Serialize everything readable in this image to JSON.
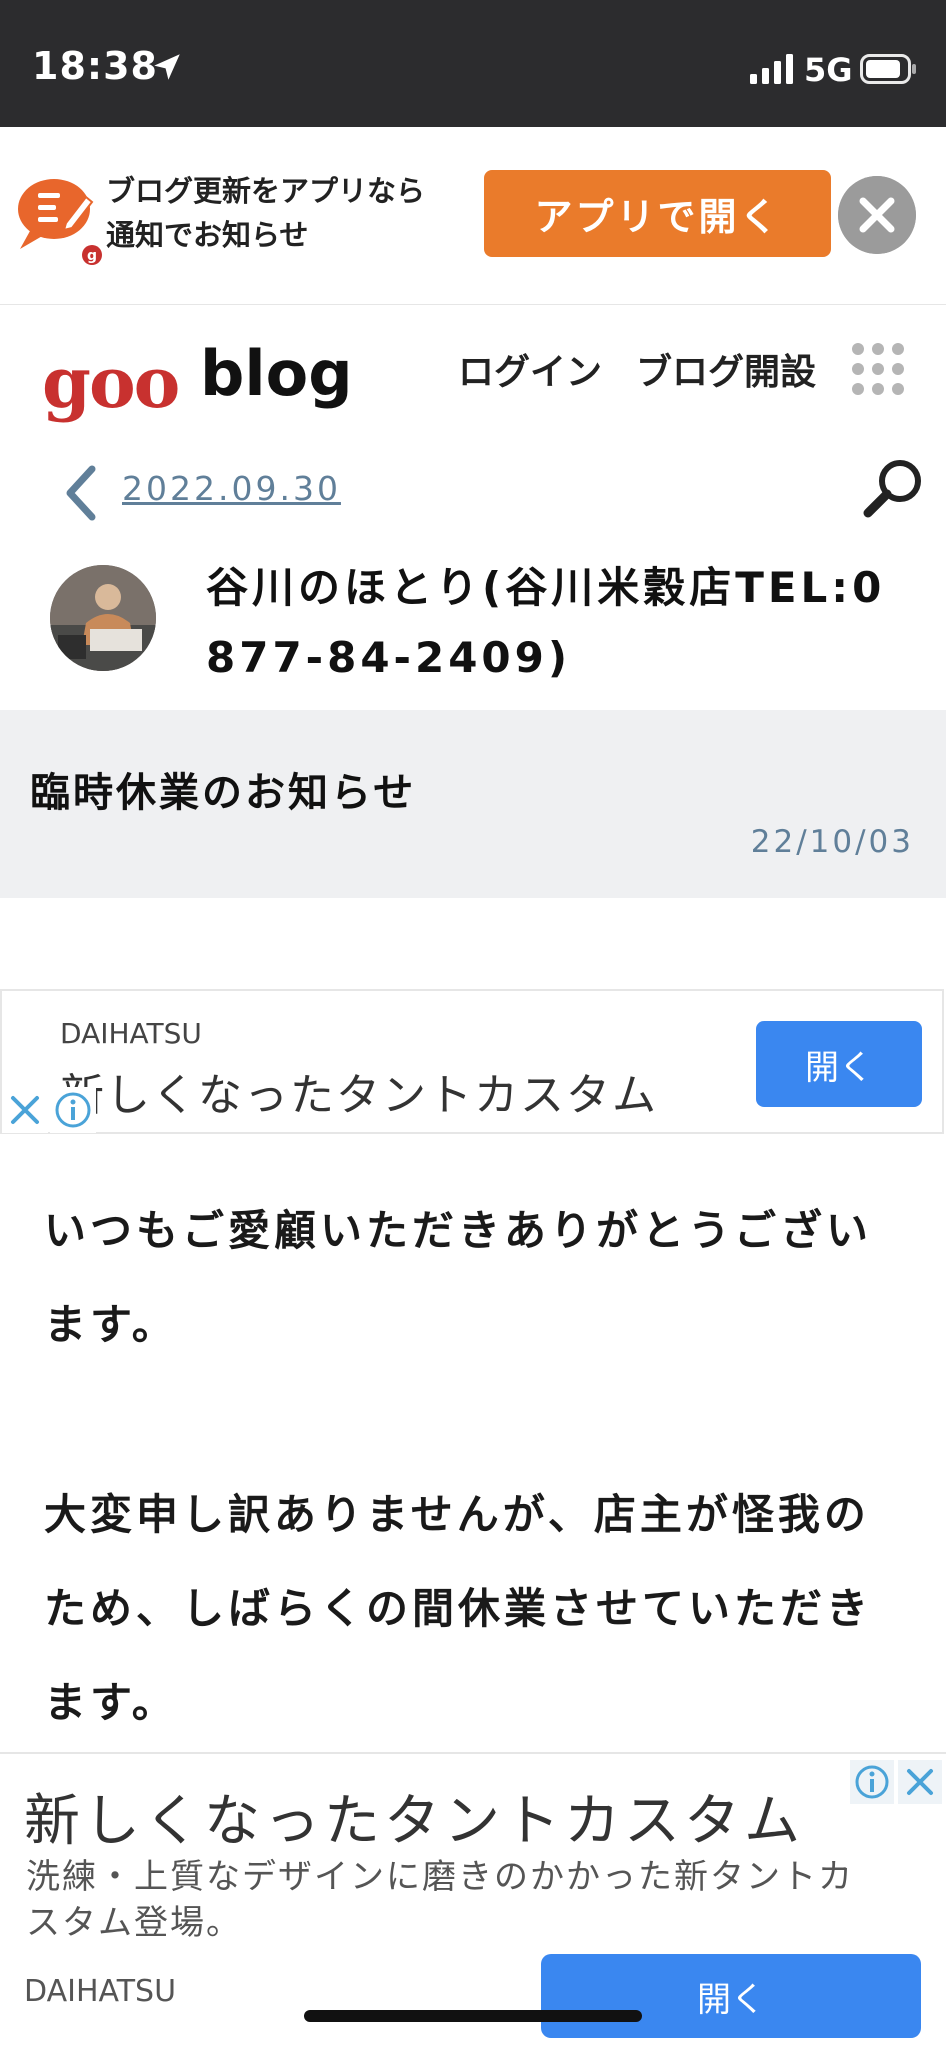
{
  "status_bar": {
    "time": "18:38",
    "network": "5G"
  },
  "app_banner": {
    "text_line1": "ブログ更新をアプリなら",
    "text_line2": "通知でお知らせ",
    "open_app_label": "アプリで開く"
  },
  "header": {
    "logo_goo": "goo",
    "logo_blog": "blog",
    "login": "ログイン",
    "open_blog": "ブログ開設",
    "date_link": "2022.09.30"
  },
  "blog": {
    "title": "谷川のほとり(谷川米穀店TEL:0877-84-2409)"
  },
  "post": {
    "title": "臨時休業のお知らせ",
    "date": "22/10/03",
    "paragraph1": "いつもご愛顧いただきありがとうございます。",
    "paragraph2": "大変申し訳ありませんが、店主が怪我のため、しばらくの間休業させていただきます。"
  },
  "ad_top": {
    "brand": "DAIHATSU",
    "headline": "新しくなったタントカスタム",
    "button": "開く"
  },
  "ad_bottom": {
    "headline": "新しくなったタントカスタム",
    "description": "洗練・上質なデザインに磨きのかかった新タントカスタム登場。",
    "brand": "DAIHATSU",
    "button": "開く"
  },
  "colors": {
    "status_bar": "#2c2c2e",
    "app_button": "#ea7b2b",
    "goo_red": "#c8312f",
    "link_blue_gray": "#607f99",
    "ad_button": "#3a87f0",
    "post_header_bg": "#eff0f2"
  },
  "icons": [
    "location-arrow-icon",
    "signal-icon",
    "battery-icon",
    "goo-app-logo-icon",
    "close-icon",
    "grid-menu-icon",
    "chevron-left-icon",
    "search-icon",
    "ad-close-icon",
    "ad-info-icon"
  ]
}
